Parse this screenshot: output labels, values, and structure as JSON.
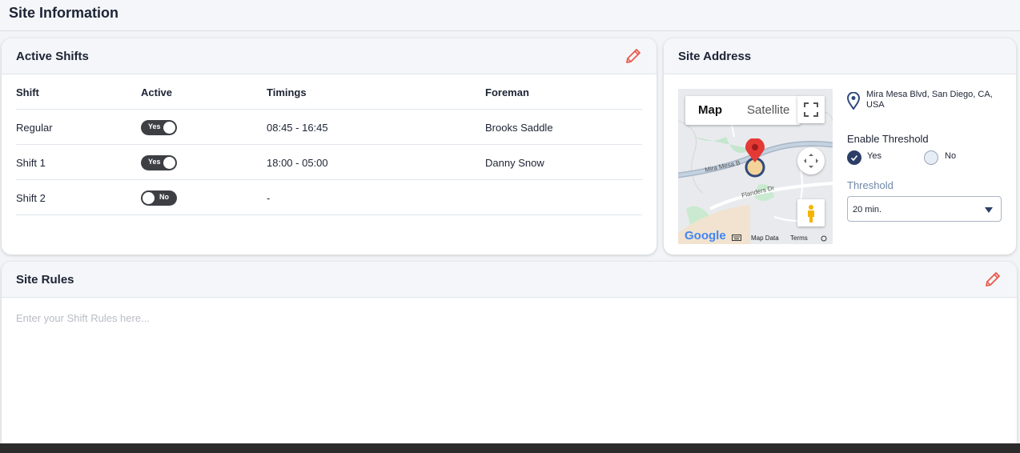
{
  "page": {
    "title": "Site Information"
  },
  "active_shifts": {
    "title": "Active Shifts",
    "columns": [
      "Shift",
      "Active",
      "Timings",
      "Foreman"
    ],
    "rows": [
      {
        "shift": "Regular",
        "active": "Yes",
        "timings": "08:45 - 16:45",
        "foreman": "Brooks Saddle"
      },
      {
        "shift": "Shift 1",
        "active": "Yes",
        "timings": "18:00 - 05:00",
        "foreman": "Danny Snow"
      },
      {
        "shift": "Shift 2",
        "active": "No",
        "timings": "-",
        "foreman": ""
      }
    ]
  },
  "site_address": {
    "title": "Site Address",
    "address": "Mira Mesa Blvd, San Diego, CA, USA",
    "map": {
      "type_map": "Map",
      "type_satellite": "Satellite",
      "street_1": "Mira Mesa B",
      "street_2": "Flanders Dr",
      "logo": "Google",
      "map_data": "Map Data",
      "terms": "Terms"
    },
    "enable_threshold_label": "Enable Threshold",
    "options": {
      "yes": "Yes",
      "no": "No",
      "selected": "Yes"
    },
    "threshold_label": "Threshold",
    "threshold_value": "20 min."
  },
  "site_rules": {
    "title": "Site Rules",
    "placeholder": "Enter your Shift Rules here..."
  },
  "colors": {
    "edit_icon": "#e8594a",
    "toggle": "#3d3f44",
    "radio_checked": "#2c3e66",
    "threshold_label": "#6f87a8",
    "pin": "#2f4a7a"
  }
}
